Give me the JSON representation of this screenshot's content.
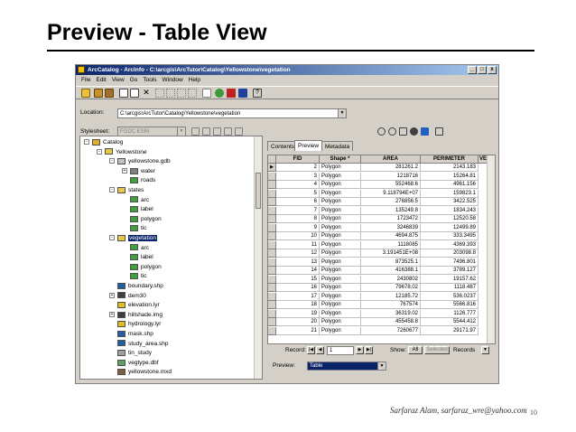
{
  "slide": {
    "title": "Preview - Table View",
    "footer": "Sarfaraz Alam, sarfaraz_wre@yahoo.com",
    "page": "10"
  },
  "window": {
    "title": "ArcCatalog - ArcInfo - C:\\arcgis\\ArcTutor\\Catalog\\Yellowstone\\vegetation",
    "menu": [
      "File",
      "Edit",
      "View",
      "Go",
      "Tools",
      "Window",
      "Help"
    ],
    "location_label": "Location:",
    "location_value": "C:\\arcgis\\ArcTutor\\Catalog\\Yellowstone\\vegetation",
    "stylesheet_label": "Stylesheet:",
    "stylesheet_value": "FGDC ESRI"
  },
  "tree": [
    {
      "label": "Catalog",
      "level": 0,
      "icon": "catalog",
      "toggle": "-"
    },
    {
      "label": "Yellowstone",
      "level": 1,
      "icon": "folder",
      "toggle": "-"
    },
    {
      "label": "yellowstone.gdb",
      "level": 2,
      "icon": "database",
      "toggle": "-"
    },
    {
      "label": "water",
      "level": 3,
      "icon": "feature-dataset",
      "toggle": "+"
    },
    {
      "label": "roads",
      "level": 3,
      "icon": "line-class",
      "toggle": ""
    },
    {
      "label": "states",
      "level": 2,
      "icon": "coverage",
      "toggle": "-"
    },
    {
      "label": "arc",
      "level": 3,
      "icon": "line-class",
      "toggle": ""
    },
    {
      "label": "label",
      "level": 3,
      "icon": "point-class",
      "toggle": ""
    },
    {
      "label": "polygon",
      "level": 3,
      "icon": "polygon-class",
      "toggle": ""
    },
    {
      "label": "tic",
      "level": 3,
      "icon": "point-class",
      "toggle": ""
    },
    {
      "label": "vegetation",
      "level": 2,
      "icon": "coverage",
      "toggle": "-",
      "selected": true
    },
    {
      "label": "arc",
      "level": 3,
      "icon": "line-class",
      "toggle": ""
    },
    {
      "label": "label",
      "level": 3,
      "icon": "point-class",
      "toggle": ""
    },
    {
      "label": "polygon",
      "level": 3,
      "icon": "polygon-class",
      "toggle": ""
    },
    {
      "label": "tic",
      "level": 3,
      "icon": "point-class",
      "toggle": ""
    },
    {
      "label": "boundary.shp",
      "level": 2,
      "icon": "shapefile",
      "toggle": ""
    },
    {
      "label": "dem30",
      "level": 2,
      "icon": "raster",
      "toggle": "+"
    },
    {
      "label": "elevation.lyr",
      "level": 2,
      "icon": "layer",
      "toggle": ""
    },
    {
      "label": "hillshade.img",
      "level": 2,
      "icon": "raster",
      "toggle": "+"
    },
    {
      "label": "hydrology.lyr",
      "level": 2,
      "icon": "layer",
      "toggle": ""
    },
    {
      "label": "mask.shp",
      "level": 2,
      "icon": "shapefile",
      "toggle": ""
    },
    {
      "label": "study_area.shp",
      "level": 2,
      "icon": "shapefile",
      "toggle": ""
    },
    {
      "label": "tin_study",
      "level": 2,
      "icon": "tin",
      "toggle": ""
    },
    {
      "label": "vegtype.dbf",
      "level": 2,
      "icon": "table",
      "toggle": ""
    },
    {
      "label": "yellowstone.mxd",
      "level": 2,
      "icon": "map-document",
      "toggle": ""
    }
  ],
  "tabs": [
    "Contents",
    "Preview",
    "Metadata"
  ],
  "table": {
    "columns": [
      "FID",
      "Shape *",
      "AREA",
      "PERIMETER",
      "VE"
    ],
    "rows": [
      [
        "2",
        "Polygon",
        "281261.2",
        "2143.183"
      ],
      [
        "3",
        "Polygon",
        "1218716",
        "15264.81"
      ],
      [
        "4",
        "Polygon",
        "552468.6",
        "4961.156"
      ],
      [
        "5",
        "Polygon",
        "9.118794E+07",
        "159823.1"
      ],
      [
        "6",
        "Polygon",
        "276856.5",
        "3422.525"
      ],
      [
        "7",
        "Polygon",
        "135249.8",
        "1834.243"
      ],
      [
        "8",
        "Polygon",
        "1723472",
        "12520.58"
      ],
      [
        "9",
        "Polygon",
        "3246839",
        "12499.89"
      ],
      [
        "10",
        "Polygon",
        "4694.875",
        "333.3495"
      ],
      [
        "11",
        "Polygon",
        "1118085",
        "4369.393"
      ],
      [
        "12",
        "Polygon",
        "3.191451E+08",
        "203098.8"
      ],
      [
        "13",
        "Polygon",
        "873525.1",
        "7496.801"
      ],
      [
        "14",
        "Polygon",
        "416388.1",
        "3789.127"
      ],
      [
        "15",
        "Polygon",
        "2430802",
        "19157.62"
      ],
      [
        "16",
        "Polygon",
        "79678.02",
        "1118.487"
      ],
      [
        "17",
        "Polygon",
        "12185.72",
        "536.0237"
      ],
      [
        "18",
        "Polygon",
        "767574",
        "5566.816"
      ],
      [
        "19",
        "Polygon",
        "36319.02",
        "1126.777"
      ],
      [
        "20",
        "Polygon",
        "455458.8",
        "5544.412"
      ],
      [
        "21",
        "Polygon",
        "7260677",
        "29171.97"
      ]
    ]
  },
  "record_bar": {
    "record_label": "Record:",
    "record_value": "1",
    "show_label": "Show:",
    "all_label": "All",
    "selected_label": "Selected",
    "records_label": "Records"
  },
  "preview_bar": {
    "label": "Preview:",
    "value": "Table"
  },
  "colors": {
    "titlebar_start": "#0a246a",
    "titlebar_end": "#a6caf0",
    "selection": "#0a246a"
  }
}
